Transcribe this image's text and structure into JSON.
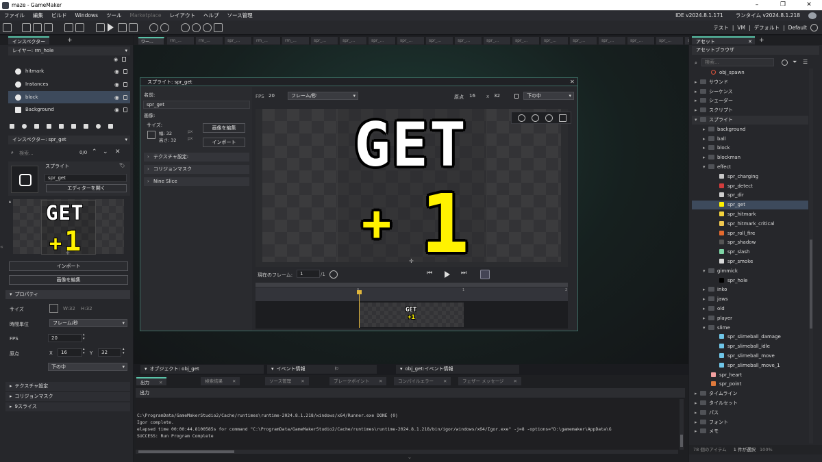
{
  "app": {
    "title": "maze - GameMaker"
  },
  "menu": {
    "items": [
      "ファイル",
      "編集",
      "ビルド",
      "Windows",
      "ツール",
      "Marketplace",
      "レイアウト",
      "ヘルプ",
      "ソース管理"
    ],
    "ide_version": "IDE v2024.8.1.171",
    "runtime_version": "ランタイム v2024.8.1.218"
  },
  "toolbar": {
    "target": [
      "テスト",
      "VM",
      "デフォルト",
      "Default"
    ],
    "sep": "|"
  },
  "left": {
    "inspector_tab": "インスペクター",
    "layer_header": "レイヤー: rm_hole",
    "layers": [
      {
        "name": "hitmark"
      },
      {
        "name": "Instances"
      },
      {
        "name": "block"
      },
      {
        "name": "Background"
      }
    ],
    "inspector2_header": "インスペクター: spr_get",
    "search_placeholder": "検索...",
    "search_count": "0/0",
    "sprite_label": "スプライト",
    "sprite_name": "spr_get",
    "open_editor": "エディターを開く",
    "import_btn": "インポート",
    "edit_image_btn": "画像を編集",
    "properties_header": "プロパティ",
    "size_label": "サイズ",
    "w": "W:32",
    "h": "H:32",
    "time_unit_label": "時間単位",
    "time_unit_value": "フレーム/秒",
    "fps_label": "FPS",
    "fps_value": "20",
    "origin_label": "原点",
    "x_label": "X",
    "x_value": "16",
    "y_label": "Y",
    "y_value": "32",
    "origin_preset": "下の中",
    "sections": [
      "テクスチャ設定",
      "コリジョンマスク",
      "9スライス"
    ]
  },
  "doc_tabs": [
    "ワー...",
    "rm_...",
    "rm_...",
    "spr_...",
    "rm_...",
    "rm_...",
    "spr_...",
    "spr_...",
    "spr_...",
    "spr_...",
    "spr_...",
    "spr_...",
    "spr_...",
    "spr_...",
    "spr_...",
    "spr_...",
    "spr_...",
    "spr_...",
    "spr_...",
    "spr_..."
  ],
  "sprite_editor": {
    "title": "スプライト: spr_get",
    "name_label": "名前:",
    "name_value": "spr_get",
    "image_label": "画像:",
    "size_label": "サイズ:",
    "width_label": "幅: 32",
    "height_label": "高さ: 32",
    "px": "px",
    "edit_image_btn": "画像を編集",
    "import_btn": "インポート",
    "accordions": [
      "テクスチャ設定:",
      "コリジョンマスク",
      "Nine Slice"
    ],
    "fps_label": "FPS",
    "fps_value": "20",
    "fps_unit": "フレーム/秒",
    "origin_label": "原点",
    "origin_x": "16",
    "origin_x_sep": "x",
    "origin_y": "32",
    "origin_preset": "下の中",
    "sprite_line1": "GET",
    "sprite_line2_plus": "+",
    "sprite_line2_num": "1",
    "current_frame_label": "現在のフレーム:",
    "current_frame": "1",
    "frame_total": "/1",
    "timeline_marks": [
      "0",
      "1",
      "2"
    ]
  },
  "bottom_headers": [
    {
      "label": "オブジェクト: obj_get"
    },
    {
      "label": "イベント情報"
    },
    {
      "label": "obj_get:イベント情報"
    }
  ],
  "output": {
    "tabs": [
      "出力",
      "検索結果",
      "ソース管理",
      "ブレークポイント",
      "コンパイルエラー",
      "フェザー メッセージ"
    ],
    "header": "出力",
    "lines": [
      "C:\\ProgramData/GameMakerStudio2/Cache/runtimes\\runtime-2024.8.1.218/windows/x64/Runner.exe DONE (0)",
      "Igor complete.",
      "elapsed time 00:00:44.8100585s for command \"C:\\ProgramData/GameMakerStudio2/Cache/runtimes\\runtime-2024.8.1.218/bin/igor/windows/x64/Igor.exe\" -j=8  -options=\"D:\\gamemaker\\AppData\\G",
      "SUCCESS: Run Program Complete"
    ]
  },
  "assets": {
    "tab": "アセット",
    "browser": "アセットブラウザ",
    "search_placeholder": "検索...",
    "tree": [
      {
        "label": "obj_spawn",
        "indent": 2,
        "kind": "obj",
        "color": "#e0553c"
      },
      {
        "label": "サウンド",
        "indent": 0,
        "kind": "folder",
        "arrow": "▸"
      },
      {
        "label": "シーケンス",
        "indent": 0,
        "kind": "folder",
        "arrow": "▸"
      },
      {
        "label": "シェーダー",
        "indent": 0,
        "kind": "folder",
        "arrow": "▸"
      },
      {
        "label": "スクリプト",
        "indent": 0,
        "kind": "folder",
        "arrow": "▸"
      },
      {
        "label": "スプライト",
        "indent": 0,
        "kind": "folder",
        "arrow": "▾",
        "selected_group": true
      },
      {
        "label": "background",
        "indent": 1,
        "kind": "folder",
        "arrow": "▸"
      },
      {
        "label": "ball",
        "indent": 1,
        "kind": "folder",
        "arrow": "▸"
      },
      {
        "label": "block",
        "indent": 1,
        "kind": "folder",
        "arrow": "▸"
      },
      {
        "label": "blockman",
        "indent": 1,
        "kind": "folder",
        "arrow": "▸"
      },
      {
        "label": "effect",
        "indent": 1,
        "kind": "folder",
        "arrow": "▾"
      },
      {
        "label": "spr_charging",
        "indent": 3,
        "kind": "spr",
        "color": "#c8c8c8"
      },
      {
        "label": "spr_detect",
        "indent": 3,
        "kind": "spr",
        "color": "#d13c3c"
      },
      {
        "label": "spr_dir",
        "indent": 3,
        "kind": "spr",
        "color": "#cfcfcf"
      },
      {
        "label": "spr_get",
        "indent": 3,
        "kind": "spr",
        "color": "#fff200",
        "selected": true
      },
      {
        "label": "spr_hitmark",
        "indent": 3,
        "kind": "spr",
        "color": "#f3d23c"
      },
      {
        "label": "spr_hitmark_critical",
        "indent": 3,
        "kind": "spr",
        "color": "#f0c850"
      },
      {
        "label": "spr_roll_fire",
        "indent": 3,
        "kind": "spr",
        "color": "#e46a2e"
      },
      {
        "label": "spr_shadow",
        "indent": 3,
        "kind": "spr",
        "color": "#555"
      },
      {
        "label": "spr_slash",
        "indent": 3,
        "kind": "spr",
        "color": "#7fd6a6"
      },
      {
        "label": "spr_smoke",
        "indent": 3,
        "kind": "spr",
        "color": "#d9d9d9"
      },
      {
        "label": "gimmick",
        "indent": 1,
        "kind": "folder",
        "arrow": "▾"
      },
      {
        "label": "spr_hole",
        "indent": 3,
        "kind": "spr",
        "color": "#000"
      },
      {
        "label": "inko",
        "indent": 1,
        "kind": "folder",
        "arrow": "▸"
      },
      {
        "label": "jaws",
        "indent": 1,
        "kind": "folder",
        "arrow": "▸"
      },
      {
        "label": "old",
        "indent": 1,
        "kind": "folder",
        "arrow": "▸"
      },
      {
        "label": "player",
        "indent": 1,
        "kind": "folder",
        "arrow": "▸"
      },
      {
        "label": "slime",
        "indent": 1,
        "kind": "folder",
        "arrow": "▾"
      },
      {
        "label": "spr_slimeball_damage",
        "indent": 3,
        "kind": "spr",
        "color": "#6fc6e8"
      },
      {
        "label": "spr_slimeball_idle",
        "indent": 3,
        "kind": "spr",
        "color": "#6fc6e8"
      },
      {
        "label": "spr_slimeball_move",
        "indent": 3,
        "kind": "spr",
        "color": "#6fc6e8"
      },
      {
        "label": "spr_slimeball_move_1",
        "indent": 3,
        "kind": "spr",
        "color": "#6fc6e8"
      },
      {
        "label": "spr_heart",
        "indent": 2,
        "kind": "spr",
        "color": "#f2a0a0"
      },
      {
        "label": "spr_point",
        "indent": 2,
        "kind": "spr",
        "color": "#e07a3c"
      },
      {
        "label": "タイムライン",
        "indent": 0,
        "kind": "folder",
        "arrow": "▸"
      },
      {
        "label": "タイルセット",
        "indent": 0,
        "kind": "folder",
        "arrow": "▸"
      },
      {
        "label": "パス",
        "indent": 0,
        "kind": "folder",
        "arrow": "▸"
      },
      {
        "label": "フォント",
        "indent": 0,
        "kind": "folder",
        "arrow": "▸"
      },
      {
        "label": "メモ",
        "indent": 0,
        "kind": "folder",
        "arrow": "▸"
      }
    ],
    "footer": "78 個のアイテム",
    "footer_sel": "1 件が選択",
    "footer_zoom": "100%"
  },
  "colors": {
    "accent": "#59c3a8",
    "highlight_yellow": "#fff200",
    "selection": "#3d4a5c"
  }
}
